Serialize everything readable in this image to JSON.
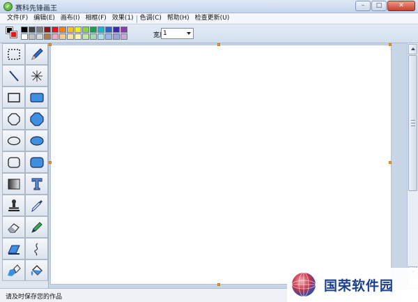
{
  "window": {
    "title": "赛科先锋画王"
  },
  "menu": {
    "items": [
      "文件(F)",
      "编辑(E)",
      "画布(I)",
      "相框(F)",
      "效果(1)",
      "色调(C)",
      "帮助(H)",
      "检查更新(U)"
    ]
  },
  "toolbar": {
    "foreground_color": "#000000",
    "background_color": "#e0191b",
    "palette": [
      "#000000",
      "#404040",
      "#7f7f7f",
      "#8b1a1a",
      "#e0191b",
      "#f07f18",
      "#f5c21a",
      "#f2f20f",
      "#8fd13a",
      "#1aa04a",
      "#22b3c8",
      "#2b64c8",
      "#3b2bb0",
      "#8a3bb0",
      "#ffffff",
      "#c0c0c0",
      "#d9d9d9",
      "#b5794b",
      "#f2a7b8",
      "#f8c98a",
      "#f8e3a0",
      "#f8f8b0",
      "#c8e8a0",
      "#a8d8b0",
      "#a8e0ec",
      "#98b8e8",
      "#a0a0d8",
      "#c8a8d8"
    ],
    "width_label": "宽度:",
    "width_value": "1"
  },
  "tools": [
    "select",
    "pencil",
    "line",
    "spray",
    "rectangle",
    "filled-rectangle",
    "circle",
    "filled-circle",
    "ellipse",
    "filled-ellipse",
    "rounded-rect",
    "filled-rounded-rect",
    "gradient",
    "text",
    "stamp",
    "eyedropper",
    "eraser",
    "marker",
    "fill-area",
    "curve",
    "highlighter",
    "paint-bucket"
  ],
  "status": {
    "text": "请及时保存您的作品"
  },
  "watermark": {
    "text": "国荣软件园"
  }
}
